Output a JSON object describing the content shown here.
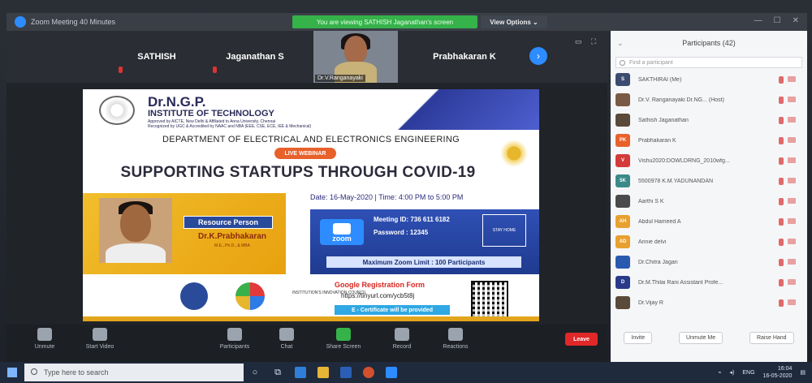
{
  "window": {
    "title": "Zoom Meeting 40 Minutes",
    "sharing_banner": "You are viewing SATHISH Jaganathan's screen",
    "view_options": "View Options ⌄"
  },
  "strip": {
    "tiles": [
      "SATHISH",
      "Jaganathan S",
      "Prabhakaran K"
    ],
    "video_name": "Dr.V.Ranganayaki"
  },
  "slide": {
    "institute": "Dr.N.G.P.",
    "institute2": "INSTITUTE OF TECHNOLOGY",
    "affil1": "Approved by AICTE, New Delhi & Affiliated to Anna University, Chennai",
    "affil2": "Recognized by UGC & Accredited by NAAC and NBA (EEE, CSE, ECE, IEE & Mechanical)",
    "department": "DEPARTMENT OF ELECTRICAL AND ELECTRONICS ENGINEERING",
    "live": "LIVE WEBINAR",
    "title": "SUPPORTING STARTUPS THROUGH COVID-19",
    "date_time": "Date: 16-May-2020  |  Time: 4:00 PM to 5:00 PM",
    "resource_label": "Resource Person",
    "speaker": "Dr.K.Prabhakaran",
    "speaker_deg": "M.E., Ph.D., & MBA",
    "meeting_id": "Meeting ID: 736 611 6182",
    "password": "Password : 12345",
    "zoom_label": "zoom",
    "stay_home": "STAY HOME",
    "max_limit": "Maximum Zoom Limit : 100 Participants",
    "registration": "Google Registration Form",
    "reg_url": "https://tinyurl.com/ycb5t8j",
    "certificate": "E - Certificate will be provided",
    "iic_text": "INSTITUTION'S INNOVATION COUNCIL"
  },
  "controls": {
    "items": [
      {
        "label": "Unmute",
        "icon": "mic-icon"
      },
      {
        "label": "Start Video",
        "icon": "video-icon"
      },
      {
        "label": "Participants",
        "icon": "participants-icon",
        "count": "42"
      },
      {
        "label": "Chat",
        "icon": "chat-icon"
      },
      {
        "label": "Share Screen",
        "icon": "share-screen-icon"
      },
      {
        "label": "Record",
        "icon": "record-icon"
      },
      {
        "label": "Reactions",
        "icon": "reactions-icon"
      }
    ],
    "leave": "Leave"
  },
  "panel": {
    "title": "Participants (42)",
    "search_placeholder": "Find a participant",
    "participants": [
      {
        "name": "SAKTHIRAI (Me)",
        "initials": "S",
        "color": "#3b4b70"
      },
      {
        "name": "Dr.V. Ranganayaki Dr.NG... (Host)",
        "initials": "",
        "color": "#7a5a44"
      },
      {
        "name": "Sathish Jaganathan",
        "initials": "",
        "color": "#5a4a3a"
      },
      {
        "name": "Prabhakaran K",
        "initials": "PK",
        "color": "#e8612b"
      },
      {
        "name": "Vishu2020:DOWLDRNG_2010wfg...",
        "initials": "V",
        "color": "#d43a3a"
      },
      {
        "name": "5500978 K.M.YADUNANDAN",
        "initials": "5K",
        "color": "#3b8a8a"
      },
      {
        "name": "Aarthi S K",
        "initials": "",
        "color": "#4a4a4a"
      },
      {
        "name": "Abdul Hameed A",
        "initials": "AH",
        "color": "#e8a030"
      },
      {
        "name": "Annie delvi",
        "initials": "AD",
        "color": "#e8a030"
      },
      {
        "name": "Dr.Chitra Jagan",
        "initials": "",
        "color": "#2a5ab0"
      },
      {
        "name": "Dr.M.Thilai Rani Assistant Profe...",
        "initials": "D",
        "color": "#2a3a8a"
      },
      {
        "name": "Dr.Vijay R",
        "initials": "",
        "color": "#5a4a3a"
      }
    ],
    "buttons": [
      "Invite",
      "Unmute Me",
      "Raise Hand"
    ]
  },
  "taskbar": {
    "search_placeholder": "Type here to search",
    "lang": "ENG",
    "time": "16:04",
    "date": "16-05-2020"
  }
}
